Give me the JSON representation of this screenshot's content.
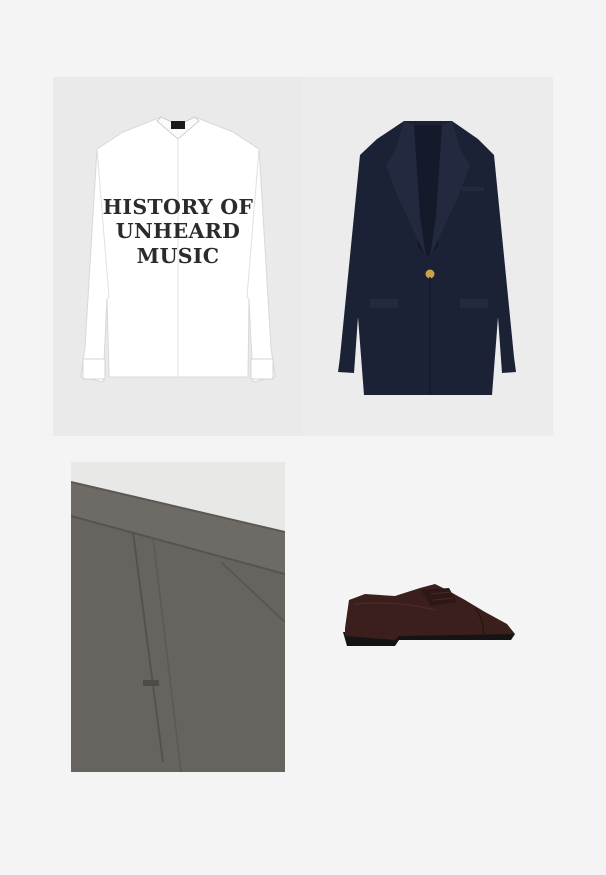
{
  "products": [
    {
      "id": "shirt",
      "name": "white-printed-shirt",
      "print_lines": [
        "HISTORY OF",
        "UNHEARD",
        "MUSIC"
      ],
      "colors": {
        "background": "#eaeaea",
        "fabric": "#ffffff",
        "print": "#2b2b2b"
      }
    },
    {
      "id": "blazer",
      "name": "navy-blazer",
      "colors": {
        "background": "#ececec",
        "fabric": "#1c2236",
        "button": "#c9a24a"
      }
    },
    {
      "id": "trousers",
      "name": "grey-wool-trousers",
      "colors": {
        "background": "#e6e6e4",
        "fabric": "#6e6a66"
      }
    },
    {
      "id": "shoe",
      "name": "brown-leather-derby-shoe",
      "colors": {
        "leather": "#3b1f1c",
        "sole": "#151313"
      }
    }
  ]
}
